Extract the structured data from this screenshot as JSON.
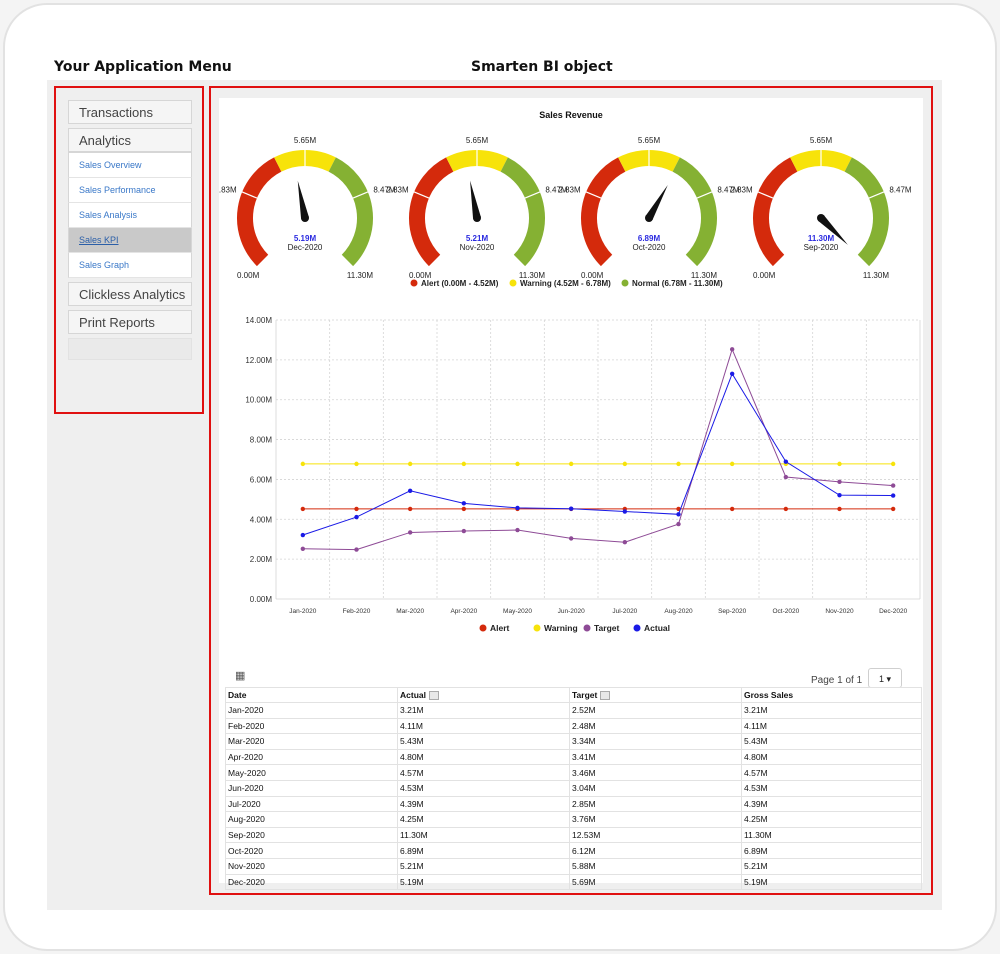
{
  "headings": {
    "menu": "Your Application Menu",
    "bi": "Smarten BI object"
  },
  "menu": {
    "sections": [
      {
        "label": "Transactions",
        "items": []
      },
      {
        "label": "Analytics",
        "items": [
          {
            "label": "Sales Overview",
            "active": false
          },
          {
            "label": "Sales Performance",
            "active": false
          },
          {
            "label": "Sales Analysis",
            "active": false
          },
          {
            "label": "Sales KPI",
            "active": true
          },
          {
            "label": "Sales Graph",
            "active": false
          }
        ]
      },
      {
        "label": "Clickless Analytics",
        "items": []
      },
      {
        "label": "Print Reports",
        "items": []
      }
    ]
  },
  "gauge_chart": {
    "title": "Sales Revenue",
    "min_label": "0.00M",
    "max_label": "11.30M",
    "min": 0,
    "max": 11.3,
    "tick_labels": [
      "2.83M",
      "5.65M",
      "8.47M"
    ],
    "bands": [
      {
        "name": "Alert",
        "from": 0,
        "to": 4.52,
        "color": "#d42a0c"
      },
      {
        "name": "Warning",
        "from": 4.52,
        "to": 6.78,
        "color": "#f7e30a"
      },
      {
        "name": "Normal",
        "from": 6.78,
        "to": 11.3,
        "color": "#85b133"
      }
    ],
    "gauges": [
      {
        "value": 5.19,
        "value_label": "5.19M",
        "period": "Dec-2020"
      },
      {
        "value": 5.21,
        "value_label": "5.21M",
        "period": "Nov-2020"
      },
      {
        "value": 6.89,
        "value_label": "6.89M",
        "period": "Oct-2020"
      },
      {
        "value": 11.3,
        "value_label": "11.30M",
        "period": "Sep-2020"
      }
    ],
    "legend": [
      "Alert (0.00M - 4.52M)",
      "Warning (4.52M - 6.78M)",
      "Normal (6.78M - 11.30M)"
    ]
  },
  "chart_data": {
    "type": "line",
    "categories": [
      "Jan-2020",
      "Feb-2020",
      "Mar-2020",
      "Apr-2020",
      "May-2020",
      "Jun-2020",
      "Jul-2020",
      "Aug-2020",
      "Sep-2020",
      "Oct-2020",
      "Nov-2020",
      "Dec-2020"
    ],
    "ylim": [
      0,
      14
    ],
    "y_ticks": [
      0,
      2,
      4,
      6,
      8,
      10,
      12,
      14
    ],
    "y_tick_labels": [
      "0.00M",
      "2.00M",
      "4.00M",
      "6.00M",
      "8.00M",
      "10.00M",
      "12.00M",
      "14.00M"
    ],
    "grid": true,
    "legend_position": "bottom",
    "series": [
      {
        "name": "Alert",
        "color": "#d42a0c",
        "values": [
          4.52,
          4.52,
          4.52,
          4.52,
          4.52,
          4.52,
          4.52,
          4.52,
          4.52,
          4.52,
          4.52,
          4.52
        ]
      },
      {
        "name": "Warning",
        "color": "#f7e30a",
        "values": [
          6.78,
          6.78,
          6.78,
          6.78,
          6.78,
          6.78,
          6.78,
          6.78,
          6.78,
          6.78,
          6.78,
          6.78
        ]
      },
      {
        "name": "Target",
        "color": "#8e4b96",
        "values": [
          2.52,
          2.48,
          3.34,
          3.41,
          3.46,
          3.04,
          2.85,
          3.76,
          12.53,
          6.12,
          5.88,
          5.69
        ]
      },
      {
        "name": "Actual",
        "color": "#1a1ae6",
        "values": [
          3.21,
          4.11,
          5.43,
          4.8,
          4.57,
          4.53,
          4.39,
          4.25,
          11.3,
          6.89,
          5.21,
          5.19
        ]
      }
    ]
  },
  "table": {
    "pager_text": "Page 1 of 1",
    "pager_value": "1",
    "columns": [
      "Date",
      "Actual",
      "Target",
      "Gross Sales"
    ],
    "rows": [
      [
        "Jan-2020",
        "3.21M",
        "2.52M",
        "3.21M"
      ],
      [
        "Feb-2020",
        "4.11M",
        "2.48M",
        "4.11M"
      ],
      [
        "Mar-2020",
        "5.43M",
        "3.34M",
        "5.43M"
      ],
      [
        "Apr-2020",
        "4.80M",
        "3.41M",
        "4.80M"
      ],
      [
        "May-2020",
        "4.57M",
        "3.46M",
        "4.57M"
      ],
      [
        "Jun-2020",
        "4.53M",
        "3.04M",
        "4.53M"
      ],
      [
        "Jul-2020",
        "4.39M",
        "2.85M",
        "4.39M"
      ],
      [
        "Aug-2020",
        "4.25M",
        "3.76M",
        "4.25M"
      ],
      [
        "Sep-2020",
        "11.30M",
        "12.53M",
        "11.30M"
      ],
      [
        "Oct-2020",
        "6.89M",
        "6.12M",
        "6.89M"
      ],
      [
        "Nov-2020",
        "5.21M",
        "5.88M",
        "5.21M"
      ],
      [
        "Dec-2020",
        "5.19M",
        "5.69M",
        "5.19M"
      ]
    ]
  }
}
